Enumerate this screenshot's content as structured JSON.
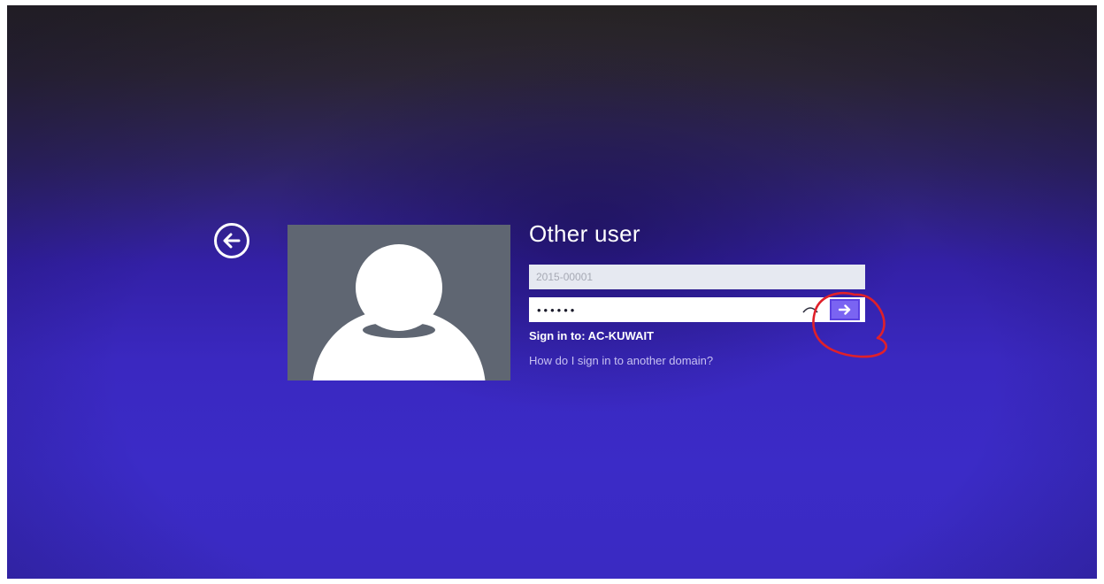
{
  "login": {
    "username_title": "Other user",
    "username_value": "2015-00001",
    "password_masked": "••••••",
    "sign_in_to_label": "Sign in to: AC-KUWAIT",
    "domain_help_link": "How do I sign in to another domain?"
  },
  "icons": {
    "back": "back-arrow-circle-icon",
    "reveal_password": "password-reveal-eye-icon",
    "submit": "right-arrow-icon",
    "avatar": "default-user-avatar-icon",
    "annotation": "red-hand-drawn-circle"
  },
  "colors": {
    "background_top": "#2d2a22",
    "background_bottom": "#3a2ac2",
    "avatar_tile": "#5f6672",
    "submit_button": "#7a64f2",
    "annotation": "#e0202a",
    "link": "#c7c1f2"
  }
}
